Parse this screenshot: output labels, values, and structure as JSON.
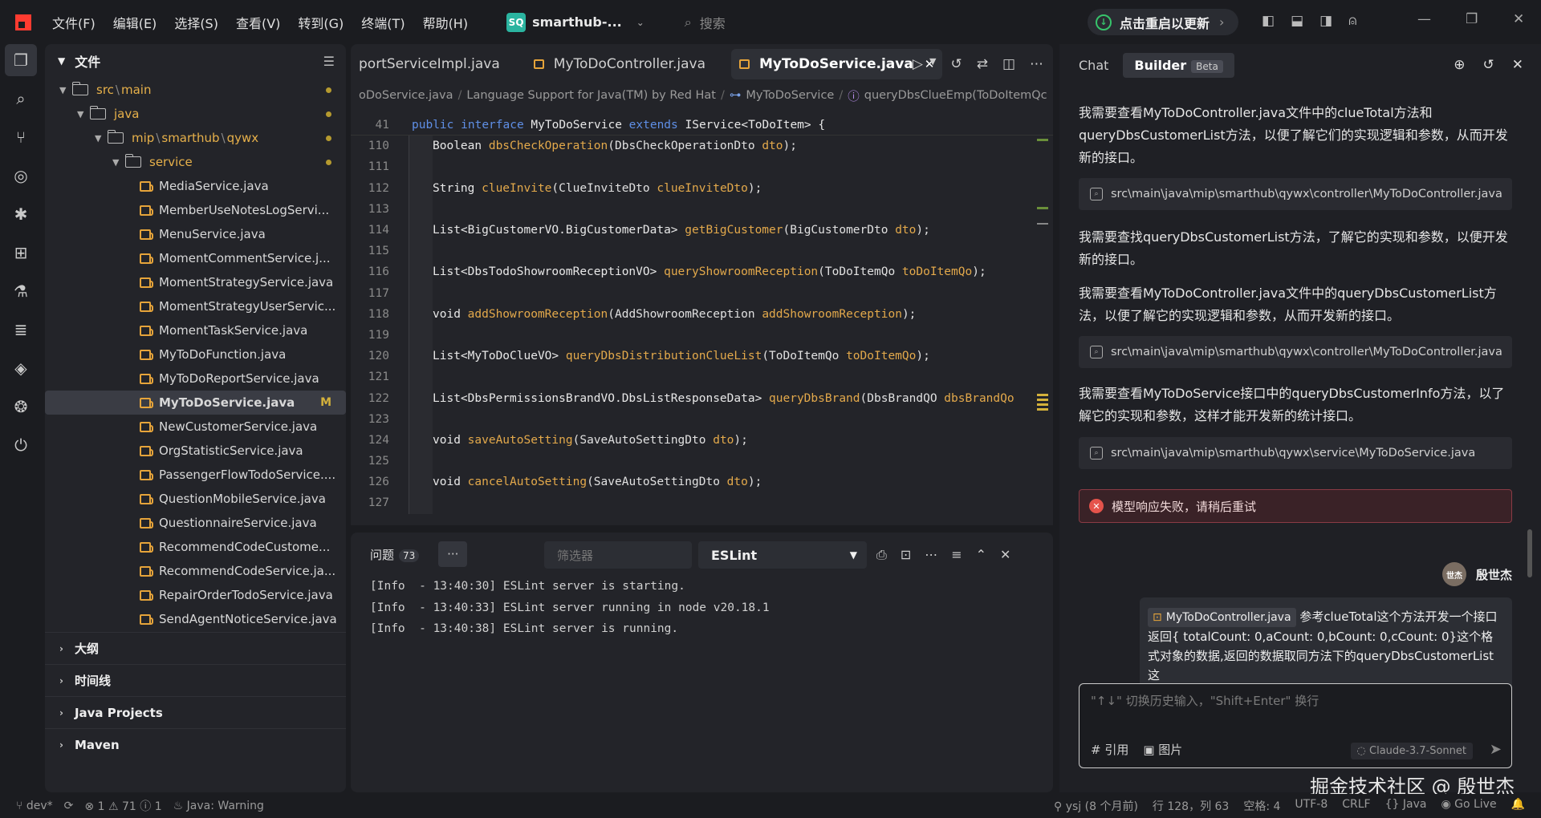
{
  "menubar": {
    "items": [
      "文件(F)",
      "编辑(E)",
      "选择(S)",
      "查看(V)",
      "转到(G)",
      "终端(T)",
      "帮助(H)"
    ],
    "project_badge": "SQ",
    "project_name": "smarthub-...",
    "search_placeholder": "搜索",
    "update_label": "点击重启以更新"
  },
  "sidebar": {
    "title": "文件",
    "folders": [
      {
        "label_a": "src",
        "label_b": "main"
      },
      {
        "label": "java"
      },
      {
        "label_a": "mip",
        "label_b": "smarthub",
        "label_c": "qywx"
      },
      {
        "label": "service"
      }
    ],
    "files": [
      "MediaService.java",
      "MemberUseNotesLogServi...",
      "MenuService.java",
      "MomentCommentService.j...",
      "MomentStrategyService.java",
      "MomentStrategyUserServic...",
      "MomentTaskService.java",
      "MyToDoFunction.java",
      "MyToDoReportService.java",
      "MyToDoService.java",
      "NewCustomerService.java",
      "OrgStatisticService.java",
      "PassengerFlowTodoService....",
      "QuestionMobileService.java",
      "QuestionnaireService.java",
      "RecommendCodeCustome...",
      "RecommendCodeService.ja...",
      "RepairOrderTodoService.java",
      "SendAgentNoticeService.java"
    ],
    "selected_modified": "M",
    "sections": [
      "大纲",
      "时间线",
      "Java Projects",
      "Maven"
    ]
  },
  "editor": {
    "tabs": [
      "portServiceImpl.java",
      "MyToDoController.java",
      "MyToDoService.java"
    ],
    "breadcrumb": [
      "oDoService.java",
      "Language Support for Java(TM) by Red Hat",
      "MyToDoService",
      "queryDbsClueEmp(ToDoItemQc"
    ],
    "sticky_line": {
      "num": "41",
      "text_kw1": "public",
      "text_kw2": "interface",
      "text_name": " MyToDoService ",
      "text_kw3": "extends",
      "text_rest": " IService<ToDoItem> {"
    },
    "lines": [
      {
        "num": "110",
        "type": "Boolean ",
        "fn": "dbsCheckOperation",
        "open": "(DbsCheckOperationDto ",
        "param": "dto",
        "close": ");"
      },
      {
        "num": "111"
      },
      {
        "num": "112",
        "type": "String ",
        "fn": "clueInvite",
        "open": "(ClueInviteDto ",
        "param": "clueInviteDto",
        "close": ");"
      },
      {
        "num": "113"
      },
      {
        "num": "114",
        "type": "List<BigCustomerVO.BigCustomerData> ",
        "fn": "getBigCustomer",
        "open": "(BigCustomerDto ",
        "param": "dto",
        "close": ");"
      },
      {
        "num": "115"
      },
      {
        "num": "116",
        "type": "List<DbsTodoShowroomReceptionVO> ",
        "fn": "queryShowroomReception",
        "open": "(ToDoItemQo ",
        "param": "toDoItemQo",
        "close": ");"
      },
      {
        "num": "117"
      },
      {
        "num": "118",
        "type": "void ",
        "fn": "addShowroomReception",
        "open": "(AddShowroomReception ",
        "param": "addShowroomReception",
        "close": ");"
      },
      {
        "num": "119"
      },
      {
        "num": "120",
        "type": "List<MyToDoClueVO> ",
        "fn": "queryDbsDistributionClueList",
        "open": "(ToDoItemQo ",
        "param": "toDoItemQo",
        "close": ");"
      },
      {
        "num": "121"
      },
      {
        "num": "122",
        "type": "List<DbsPermissionsBrandVO.DbsListResponseData> ",
        "fn": "queryDbsBrand",
        "open": "(DbsBrandQO ",
        "param": "dbsBrandQo",
        "close": ""
      },
      {
        "num": "123"
      },
      {
        "num": "124",
        "type": "void ",
        "fn": "saveAutoSetting",
        "open": "(SaveAutoSettingDto ",
        "param": "dto",
        "close": ");"
      },
      {
        "num": "125"
      },
      {
        "num": "126",
        "type": "void ",
        "fn": "cancelAutoSetting",
        "open": "(SaveAutoSettingDto ",
        "param": "dto",
        "close": ");"
      },
      {
        "num": "127"
      }
    ]
  },
  "panel": {
    "tab_label": "问题",
    "tab_count": "73",
    "more": "···",
    "filter_placeholder": "筛选器",
    "select_value": "ESLint",
    "output": [
      "[Info  - 13:40:30] ESLint server is starting.",
      "[Info  - 13:40:33] ESLint server running in node v20.18.1",
      "[Info  - 13:40:38] ESLint server is running."
    ]
  },
  "chat": {
    "tab_chat": "Chat",
    "tab_builder": "Builder",
    "beta": "Beta",
    "messages": [
      "我需要查看MyToDoController.java文件中的clueTotal方法和queryDbsCustomerList方法，以便了解它们的实现逻辑和参数，从而开发新的接口。",
      "我需要查找queryDbsCustomerList方法，了解它的实现和参数，以便开发新的接口。",
      "我需要查看MyToDoController.java文件中的queryDbsCustomerList方法，以便了解它的实现逻辑和参数，从而开发新的接口。",
      "我需要查看MyToDoService接口中的queryDbsCustomerInfo方法，以了解它的实现和参数，这样才能开发新的统计接口。"
    ],
    "file_refs": [
      "src\\main\\java\\mip\\smarthub\\qywx\\controller\\MyToDoController.java",
      "src\\main\\java\\mip\\smarthub\\qywx\\controller\\MyToDoController.java",
      "src\\main\\java\\mip\\smarthub\\qywx\\service\\MyToDoService.java"
    ],
    "error": "模型响应失败，请稍后重试",
    "user_name": "殷世杰",
    "user_avatar": "世杰",
    "user_file": "MyToDoController.java",
    "user_message": " 参考clueTotal这个方法开发一个接口返回{ totalCount: 0,aCount: 0,bCount: 0,cCount: 0}这个格式对象的数据,返回的数据取同方法下的queryDbsCustomerList这",
    "input_placeholder": "\"↑↓\" 切换历史输入，\"Shift+Enter\" 换行",
    "tool_ref": "# 引用",
    "tool_image": "图片",
    "model": "Claude-3.7-Sonnet"
  },
  "watermark": "掘金技术社区 @ 殷世杰",
  "status": {
    "branch": "dev*",
    "errors": "1",
    "warnings": "71",
    "info": "1",
    "java": "Java: Warning",
    "git_user": "ysj (8 个月前)",
    "position": "行 128，列 63",
    "spaces": "空格: 4",
    "encoding": "UTF-8",
    "eol": "CRLF",
    "lang": "Java",
    "golive": "Go Live"
  },
  "colors": {
    "accent_update": "#37c46b",
    "java_icon": "#e6a43a",
    "error": "#e5534b"
  }
}
